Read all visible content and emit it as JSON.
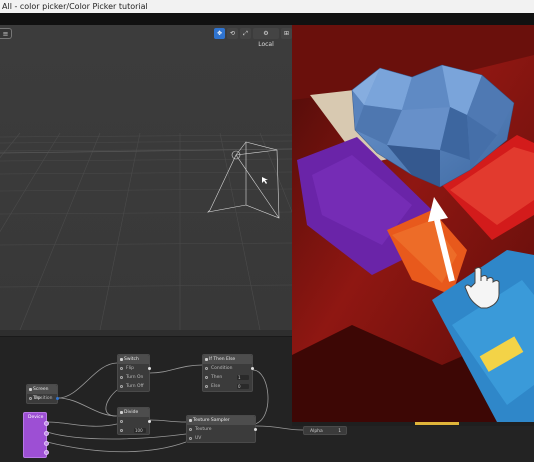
{
  "window": {
    "title": "All - color picker/Color Picker tutorial"
  },
  "viewport": {
    "menu_glyph": "≡",
    "toolbar": {
      "move_icon": "✥",
      "rotate_icon": "⟲",
      "scale_icon": "⤢",
      "local_label": "Local",
      "gear_icon": "⚙",
      "grid_icon": "⊞"
    }
  },
  "graph": {
    "nodes": {
      "screen_tap": {
        "title": "Screen Tap",
        "rows": [
          "Position"
        ]
      },
      "switch": {
        "title": "Switch",
        "rows": [
          "Flip",
          "Turn On",
          "Turn Off"
        ]
      },
      "if_then_else": {
        "title": "If Then Else",
        "rows": [
          "Condition",
          "Then",
          "Else"
        ],
        "values": [
          "",
          "1",
          "0"
        ]
      },
      "divide": {
        "title": "Divide",
        "rows": [
          "",
          ""
        ],
        "values": [
          "",
          "100"
        ]
      },
      "texture_sampler": {
        "title": "Texture Sampler",
        "rows": [
          "Texture",
          "UV"
        ]
      },
      "device": {
        "title": "Device"
      },
      "alpha": {
        "title": "Alpha",
        "value": "1"
      }
    }
  },
  "colors": {
    "accent": "#2f74d0",
    "purple_node": "#9d4fd4",
    "highlight": "#e0b53a",
    "couch_red": "#8f1712",
    "heart_blue": "#5b86bf"
  }
}
